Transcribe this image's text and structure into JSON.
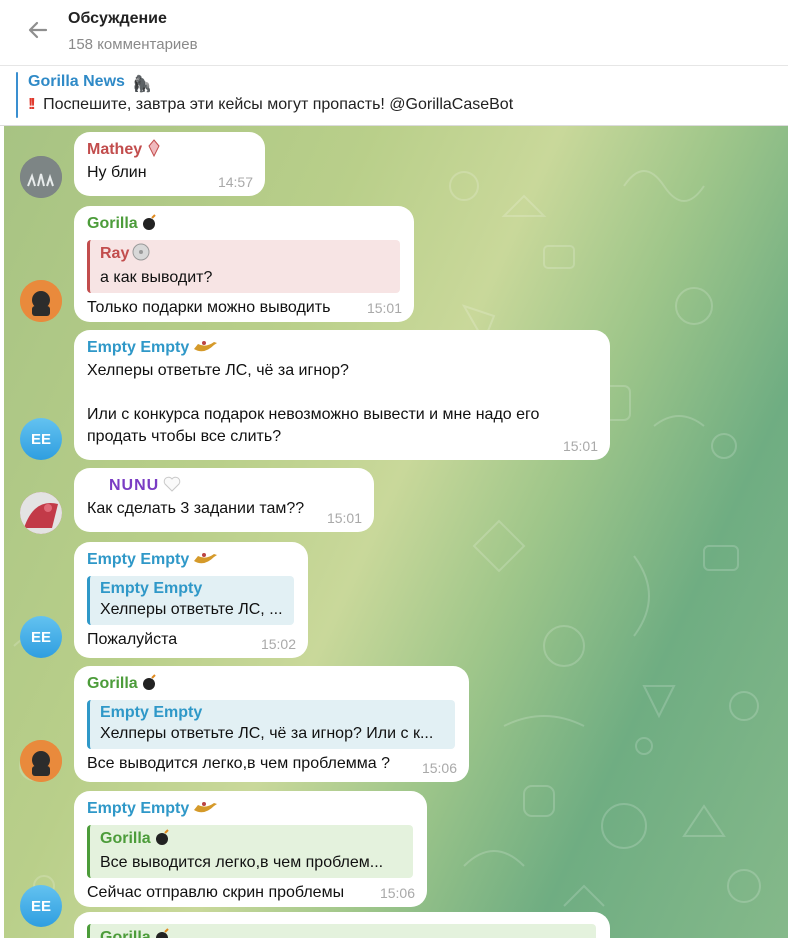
{
  "header": {
    "title": "Обсуждение",
    "subtitle": "158 комментариев"
  },
  "pinned": {
    "name": "Gorilla News",
    "emoji": "🦍",
    "text": "Поспешите, завтра эти кейсы могут пропасть!  @GorillaCaseBot"
  },
  "colors": {
    "mathey": "#c24d4d",
    "gorilla": "#4c9c3a",
    "empty": "#2f98c8",
    "nunu": "#7a3cc4",
    "ray": "#c24d4d"
  },
  "messages": [
    {
      "sender": "Mathey",
      "text": "Ну блин",
      "time": "14:57"
    },
    {
      "sender": "Gorilla",
      "reply_name": "Ray",
      "reply_text": "а как выводит?",
      "text": "Только подарки можно выводить",
      "time": "15:01"
    },
    {
      "sender": "Empty Empty",
      "avatar": "EE",
      "text_line1": "Хелперы ответьте ЛС, чё за игнор?",
      "text_line2": "Или с конкурса подарок невозможно вывести и мне надо его",
      "text_line3": "продать чтобы все слить?",
      "time": "15:01"
    },
    {
      "sender": "NUNU",
      "text": "Как сделать 3 задании там??",
      "time": "15:01"
    },
    {
      "sender": "Empty Empty",
      "avatar": "EE",
      "reply_name": "Empty Empty",
      "reply_text": "Хелперы ответьте ЛС, ...",
      "text": "Пожалуйста",
      "time": "15:02"
    },
    {
      "sender": "Gorilla",
      "reply_name": "Empty Empty",
      "reply_text": "Хелперы ответьте ЛС, чё за игнор?  Или с к...",
      "text": "Все выводится легко,в чем проблемма ?",
      "time": "15:06"
    },
    {
      "sender": "Empty Empty",
      "avatar": "EE",
      "reply_name": "Gorilla",
      "reply_text": "Все выводится легко,в чем проблем...",
      "text": "Сейчас отправлю скрин проблемы",
      "time": "15:06"
    },
    {
      "reply_name": "Gorilla"
    }
  ]
}
